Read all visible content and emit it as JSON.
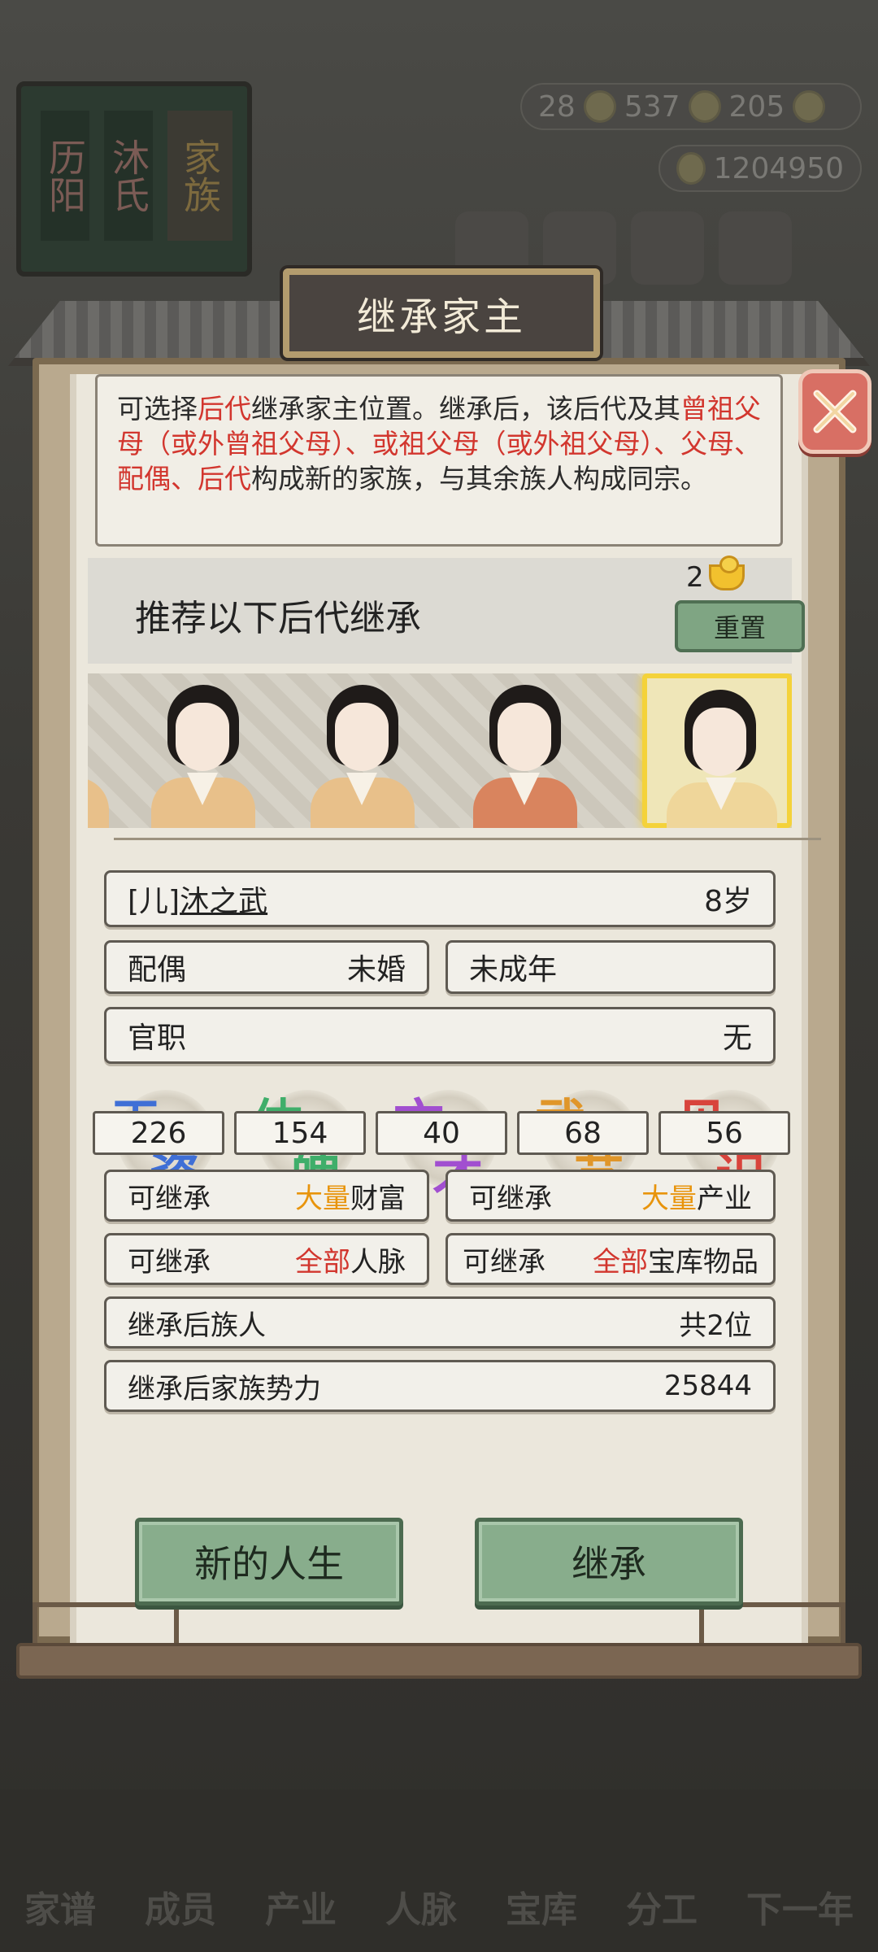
{
  "background": {
    "book_label_1": "历阳",
    "book_label_2": "沐氏",
    "book_label_3": "家族",
    "resources": [
      {
        "value": "28"
      },
      {
        "value": "537"
      },
      {
        "value": "205"
      }
    ],
    "money": "1204950",
    "nav": [
      "家谱",
      "成员",
      "产业",
      "人脉",
      "宝库",
      "分工",
      "下一年"
    ]
  },
  "dialog": {
    "title": "继承家主",
    "description": {
      "p1": "可选择",
      "p2": "后代",
      "p3": "继承家主位置。继承后，该后代及其",
      "p4": "曾祖父母（或外曾祖父母）、或祖父母（或外祖父母）、父母、配偶、后代",
      "p5": "构成新的家族，与其余族人构成同宗。"
    },
    "recommend_title": "推荐以下后代继承",
    "reset_cost": "2",
    "reset_label": "重置",
    "selected": {
      "name_prefix": "[儿]",
      "name": "沐之武",
      "age": "8岁",
      "spouse_label": "配偶",
      "spouse_value": "未婚",
      "status": "未成年",
      "office_label": "官职",
      "office_value": "无"
    },
    "stats": [
      {
        "c1": "天",
        "c2": "资",
        "value": "226",
        "color": "#3f6fd6"
      },
      {
        "c1": "体",
        "c2": "魄",
        "value": "154",
        "color": "#3fae6a"
      },
      {
        "c1": "文",
        "c2": "才",
        "value": "40",
        "color": "#a14fd0"
      },
      {
        "c1": "武",
        "c2": "艺",
        "value": "68",
        "color": "#e0962a"
      },
      {
        "c1": "见",
        "c2": "识",
        "value": "56",
        "color": "#d8443c"
      }
    ],
    "inherit": {
      "wealth_pre": "可继承",
      "wealth_amt": "大量",
      "wealth_item": "财富",
      "industry_pre": "可继承",
      "industry_amt": "大量",
      "industry_item": "产业",
      "network_pre": "可继承",
      "network_amt": "全部",
      "network_item": "人脉",
      "treasury_pre": "可继承",
      "treasury_amt": "全部",
      "treasury_item": "宝库物品",
      "members_label": "继承后族人",
      "members_value": "共2位",
      "power_label": "继承后家族势力",
      "power_value": "25844"
    },
    "new_life_label": "新的人生",
    "inherit_label": "继承"
  }
}
